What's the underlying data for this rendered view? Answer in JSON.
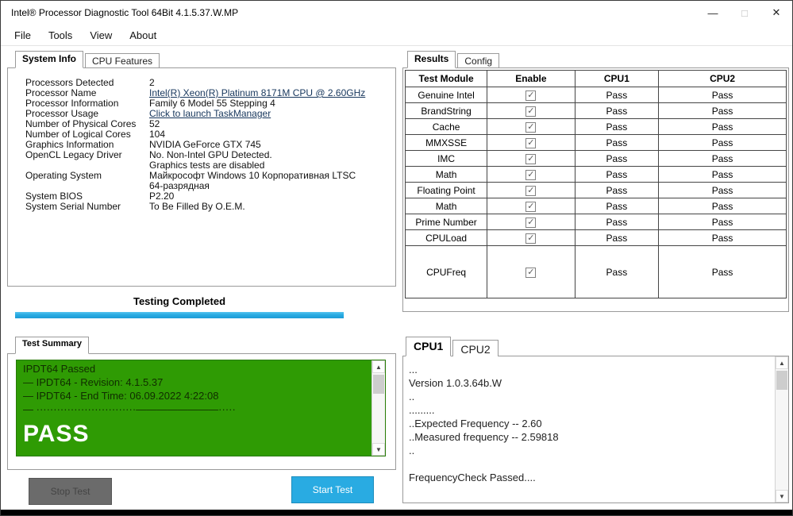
{
  "window": {
    "title": "Intel® Processor Diagnostic Tool 64Bit 4.1.5.37.W.MP",
    "controls": {
      "minimize": "—",
      "maximize": "□",
      "close": "✕"
    }
  },
  "menu": {
    "items": [
      "File",
      "Tools",
      "View",
      "About"
    ]
  },
  "system_info": {
    "tabs": {
      "system_info": "System Info",
      "cpu_features": "CPU Features"
    },
    "rows": [
      {
        "label": "Processors Detected",
        "value": "2"
      },
      {
        "label": "Processor Name",
        "value": "Intel(R) Xeon(R) Platinum 8171M CPU @ 2.60GHz"
      },
      {
        "label": "Processor Information",
        "value": "Family 6 Model 55 Stepping 4"
      },
      {
        "label": "Processor Usage",
        "value": "Click to launch TaskManager"
      },
      {
        "label": "Number of Physical Cores",
        "value": "52"
      },
      {
        "label": "Number of Logical Cores",
        "value": "104"
      },
      {
        "label": "Graphics Information",
        "value": "NVIDIA GeForce GTX 745"
      },
      {
        "label": "OpenCL Legacy Driver",
        "value": "No. Non-Intel GPU Detected."
      },
      {
        "label": "",
        "value": "Graphics tests are disabled"
      },
      {
        "label": "Operating System",
        "value": "Майкрософт Windows 10 Корпоративная LTSC"
      },
      {
        "label": "",
        "value": "64-разрядная"
      },
      {
        "label": "System BIOS",
        "value": "P2.20"
      },
      {
        "label": "System Serial Number",
        "value": "To Be Filled By O.E.M."
      }
    ]
  },
  "progress": {
    "status": "Testing Completed"
  },
  "test_summary": {
    "tab": "Test Summary",
    "lines": [
      "IPDT64 Passed",
      "— IPDT64 - Revision: 4.1.5.37",
      "— IPDT64 - End Time: 06.09.2022 4:22:08",
      "— ·····························————————·····"
    ],
    "result": "PASS"
  },
  "buttons": {
    "stop": "Stop Test",
    "start": "Start Test"
  },
  "results": {
    "tabs": {
      "results": "Results",
      "config": "Config"
    },
    "table": {
      "headers": [
        "Test Module",
        "Enable",
        "CPU1",
        "CPU2"
      ],
      "rows": [
        {
          "module": "Genuine Intel",
          "check": "✓",
          "cpu1": "Pass",
          "cpu2": "Pass"
        },
        {
          "module": "BrandString",
          "check": "✓",
          "cpu1": "Pass",
          "cpu2": "Pass"
        },
        {
          "module": "Cache",
          "check": "✓",
          "cpu1": "Pass",
          "cpu2": "Pass"
        },
        {
          "module": "MMXSSE",
          "check": "✓",
          "cpu1": "Pass",
          "cpu2": "Pass"
        },
        {
          "module": "IMC",
          "check": "✓",
          "cpu1": "Pass",
          "cpu2": "Pass"
        },
        {
          "module": "Math",
          "check": "✓",
          "cpu1": "Pass",
          "cpu2": "Pass"
        },
        {
          "module": "Floating Point",
          "check": "✓",
          "cpu1": "Pass",
          "cpu2": "Pass"
        },
        {
          "module": "Math",
          "check": "✓",
          "cpu1": "Pass",
          "cpu2": "Pass"
        },
        {
          "module": "Prime Number",
          "check": "✓",
          "cpu1": "Pass",
          "cpu2": "Pass"
        },
        {
          "module": "CPULoad",
          "check": "✓",
          "cpu1": "Pass",
          "cpu2": "Pass"
        },
        {
          "module": "CPUFreq",
          "check": "✓",
          "cpu1": "Pass",
          "cpu2": "Pass"
        }
      ]
    }
  },
  "cpu_log": {
    "tabs": {
      "cpu1": "CPU1",
      "cpu2": "CPU2"
    },
    "lines": [
      "...",
      "Version 1.0.3.64b.W",
      "..",
      ".........",
      "..Expected Frequency -- 2.60",
      "..Measured frequency -- 2.59818",
      "..",
      "",
      "FrequencyCheck Passed...."
    ]
  },
  "icons": {
    "scroll_up": "▲",
    "scroll_down": "▼"
  },
  "colors": {
    "accent_blue": "#29abe2",
    "pass_green": "#00a33c",
    "summary_green": "#2f9b04",
    "stop_gray": "#6b6b6b"
  }
}
